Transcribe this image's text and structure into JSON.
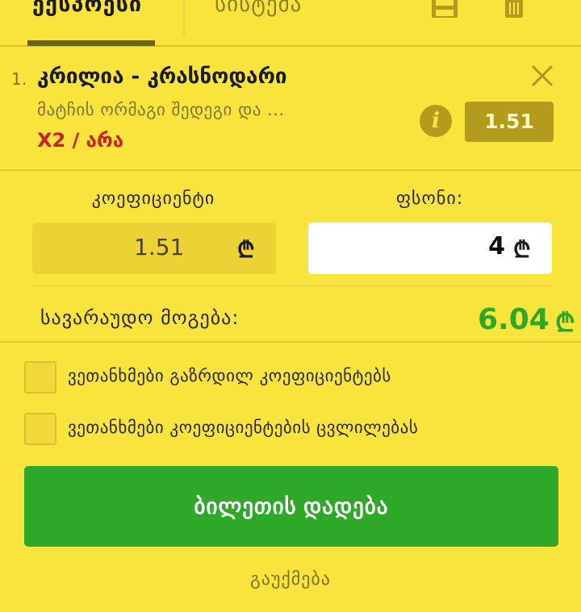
{
  "tabs": {
    "express": "ექსპრესი",
    "system": "სისტემა"
  },
  "icons": {
    "save": "save-icon",
    "trash": "trash-icon",
    "close": "close-icon",
    "info": "info-icon",
    "currency": "lari-icon"
  },
  "bet": {
    "number": "1.",
    "title": "კრილია - კრასნოდარი",
    "market": "მატჩის ორმაგი შედეგი და ...",
    "selection": "X2 / არა",
    "odds": "1.51",
    "info_symbol": "i"
  },
  "form": {
    "odds_label": "კოეფიციენტი",
    "stake_label": "ფსონი:",
    "odds_value": "1.51",
    "stake_value": "4",
    "currency_symbol": "₾"
  },
  "win": {
    "label": "სავარაუდო მოგება:",
    "value": "6.04",
    "currency_symbol": "₾"
  },
  "options": {
    "accept_increased": "ვეთანხმები გაზრდილ კოეფიციენტებს",
    "accept_changes": "ვეთანხმები კოეფიციენტების ცვლილებას"
  },
  "actions": {
    "place_bet": "ბილეთის დადება",
    "cancel": "გაუქმება"
  },
  "colors": {
    "background": "#f8e43c",
    "accent_dark": "#b39b1c",
    "green": "#2ea829",
    "red": "#d11f1f"
  }
}
